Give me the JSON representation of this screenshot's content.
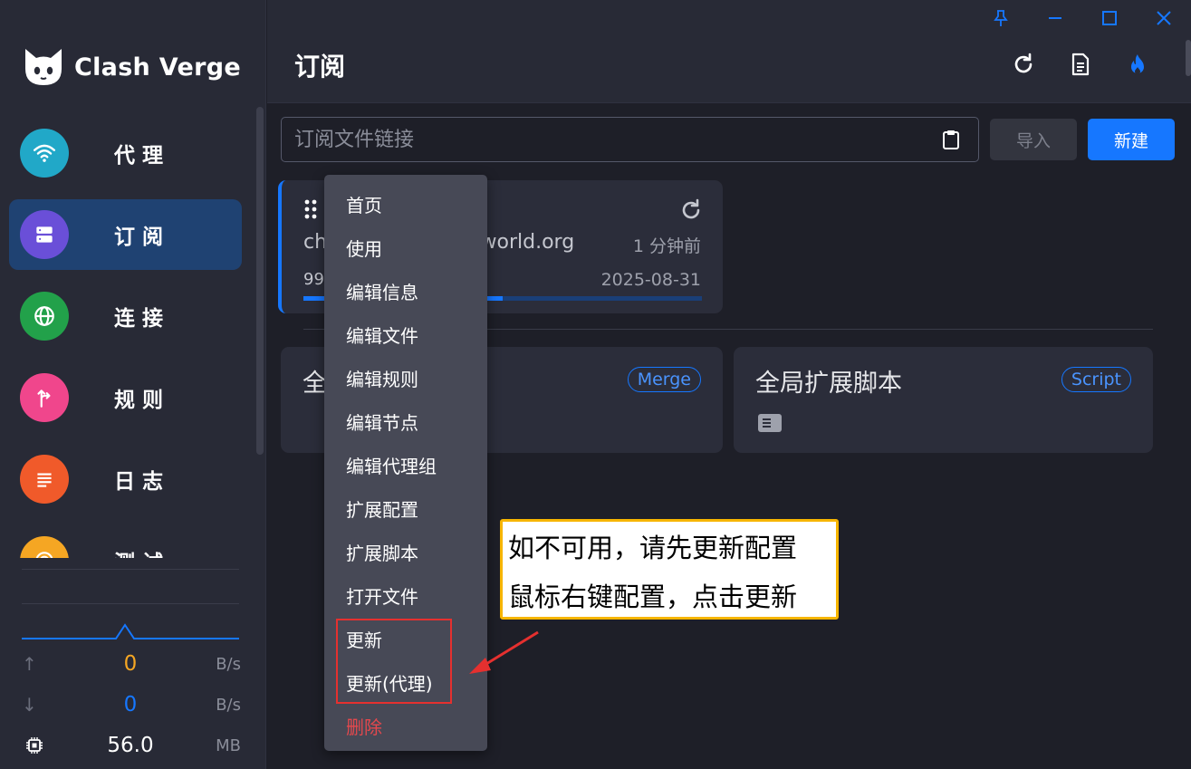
{
  "app": {
    "name": "Clash Verge"
  },
  "sidebar": {
    "items": [
      {
        "label": "代理",
        "icon": "wifi-icon",
        "color": "#21a8c8"
      },
      {
        "label": "订阅",
        "icon": "server-icon",
        "color": "#6a4fd8",
        "active": true
      },
      {
        "label": "连接",
        "icon": "globe-icon",
        "color": "#22a14a"
      },
      {
        "label": "规则",
        "icon": "route-icon",
        "color": "#f0468c"
      },
      {
        "label": "日志",
        "icon": "log-icon",
        "color": "#f05a2a"
      },
      {
        "label": "测试",
        "icon": "radar-icon",
        "color": "#f5a623"
      }
    ],
    "upload": {
      "value": "0",
      "unit": "B/s",
      "color": "#f5a623"
    },
    "download": {
      "value": "0",
      "unit": "B/s",
      "color": "#1677ff"
    },
    "memory": {
      "value": "56.0",
      "unit": "MB"
    }
  },
  "header": {
    "title": "订阅"
  },
  "subscription": {
    "url_placeholder": "订阅文件链接",
    "import_label": "导入",
    "new_label": "新建"
  },
  "profile_card": {
    "url_left": "ch",
    "url_right": "al-world.org",
    "updated": "1 分钟前",
    "usage": "99",
    "expire": "2025-08-31",
    "progress": 0.5
  },
  "ext_cards": [
    {
      "title": "全",
      "tag": "Merge"
    },
    {
      "title": "全局扩展脚本",
      "tag": "Script"
    }
  ],
  "context_menu": {
    "items": [
      {
        "label": "首页"
      },
      {
        "label": "使用"
      },
      {
        "label": "编辑信息"
      },
      {
        "label": "编辑文件"
      },
      {
        "label": "编辑规则"
      },
      {
        "label": "编辑节点"
      },
      {
        "label": "编辑代理组"
      },
      {
        "label": "扩展配置"
      },
      {
        "label": "扩展脚本"
      },
      {
        "label": "打开文件"
      },
      {
        "label": "更新"
      },
      {
        "label": "更新(代理)"
      },
      {
        "label": "删除",
        "danger": true
      }
    ]
  },
  "annotation": {
    "line1": "如不可用，请先更新配置",
    "line2": "鼠标右键配置，点击更新"
  }
}
